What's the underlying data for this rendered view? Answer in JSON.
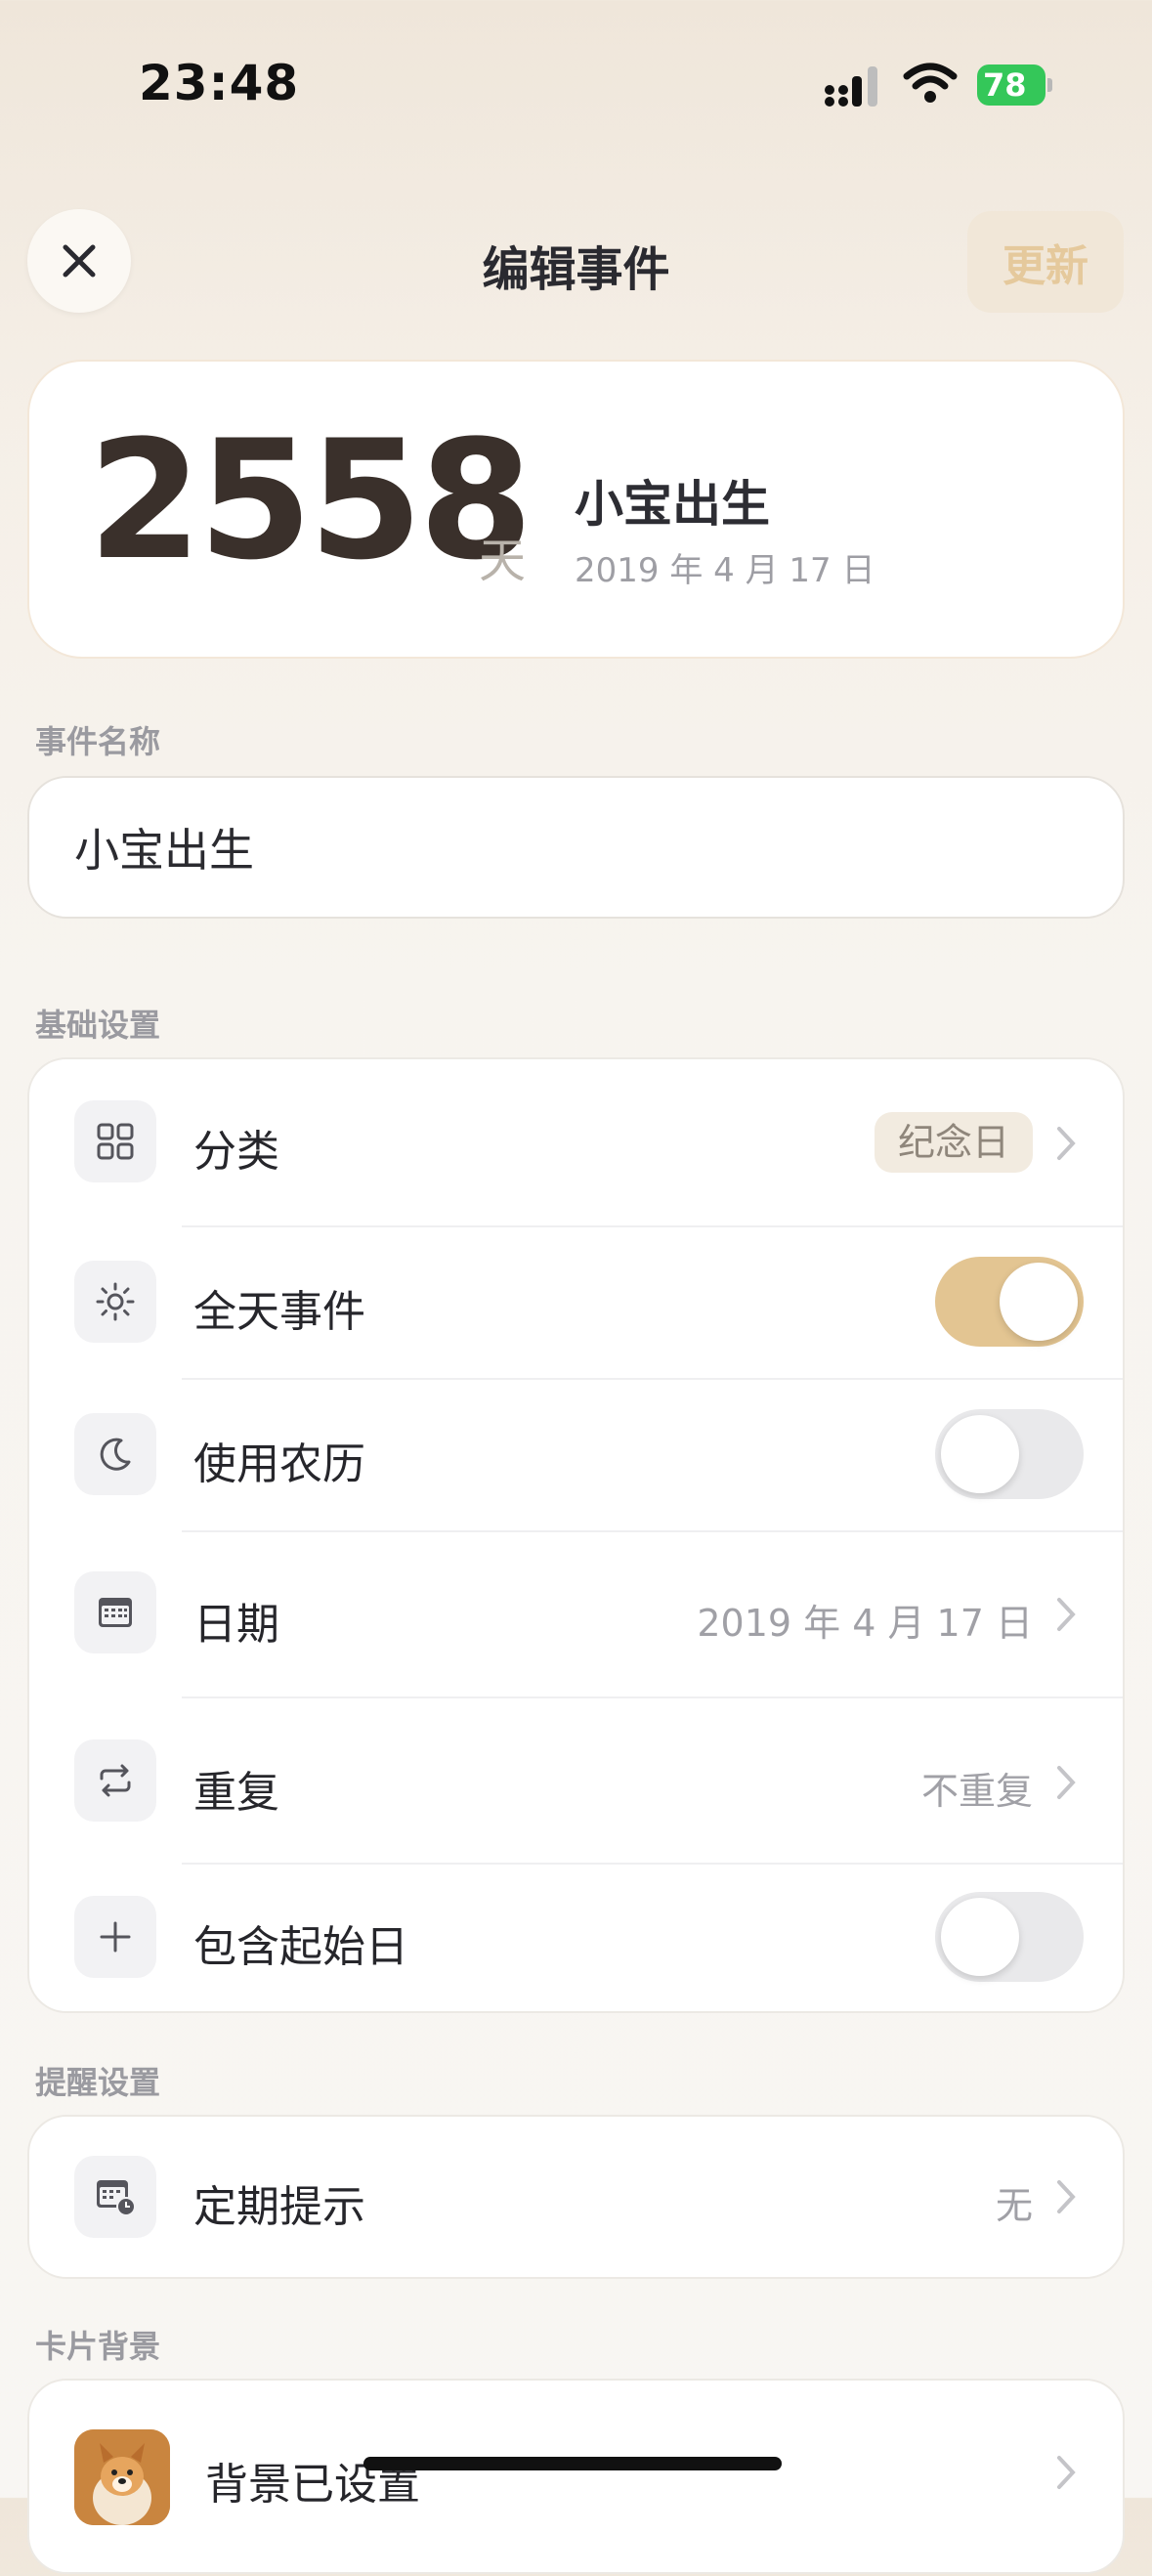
{
  "status": {
    "time": "23:48",
    "battery": "78"
  },
  "nav": {
    "title": "编辑事件",
    "update_label": "更新"
  },
  "hero": {
    "days": "2558",
    "unit": "天",
    "title": "小宝出生",
    "date": "2019 年 4 月 17 日"
  },
  "name_section": {
    "label": "事件名称",
    "value": "小宝出生"
  },
  "basic": {
    "label": "基础设置",
    "category": {
      "label": "分类",
      "value": "纪念日"
    },
    "all_day": {
      "label": "全天事件",
      "on": true
    },
    "lunar": {
      "label": "使用农历",
      "on": false
    },
    "date": {
      "label": "日期",
      "value": "2019 年 4 月 17 日"
    },
    "repeat": {
      "label": "重复",
      "value": "不重复"
    },
    "include_start": {
      "label": "包含起始日",
      "on": false
    }
  },
  "reminder": {
    "label": "提醒设置",
    "periodic": {
      "label": "定期提示",
      "value": "无"
    }
  },
  "background": {
    "label": "卡片背景",
    "item": {
      "label": "背景已设置"
    }
  },
  "colors": {
    "accent": "#e3c592",
    "battery": "#34c759"
  }
}
